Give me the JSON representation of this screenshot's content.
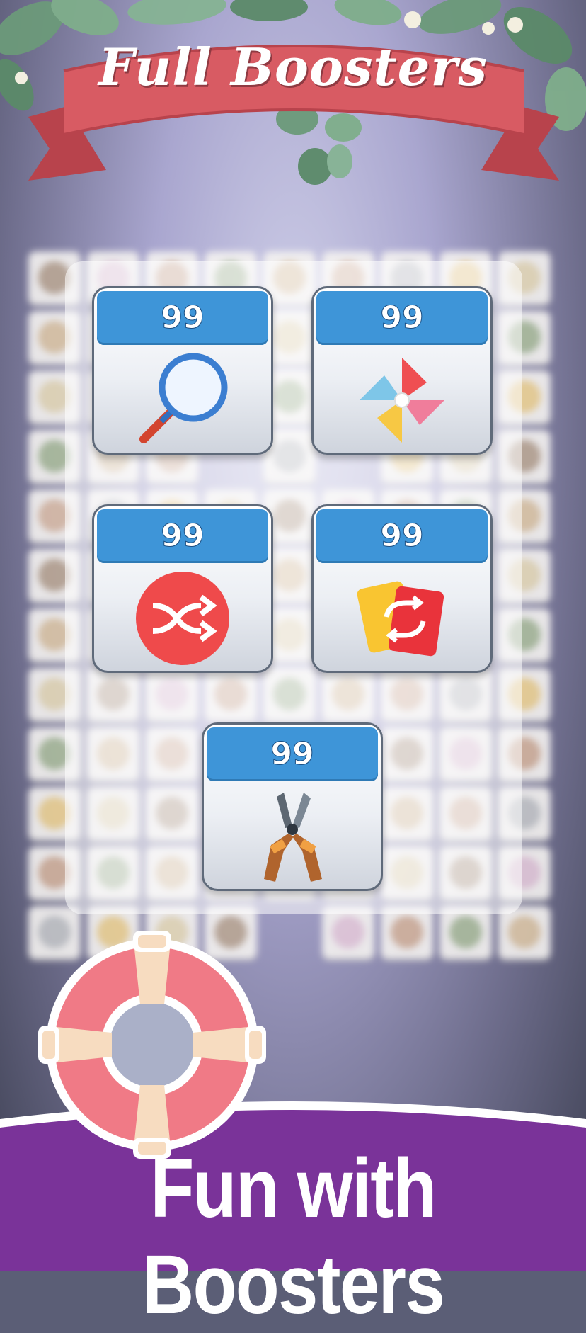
{
  "banner": {
    "title": "Full Boosters"
  },
  "boosters": [
    {
      "name": "search-icon",
      "count": "99"
    },
    {
      "name": "pinwheel-icon",
      "count": "99"
    },
    {
      "name": "shuffle-icon",
      "count": "99"
    },
    {
      "name": "swap-cards-icon",
      "count": "99"
    },
    {
      "name": "pruning-shears-icon",
      "count": "99"
    }
  ],
  "footer": {
    "tagline": "Fun with Boosters"
  },
  "colors": {
    "ribbon": "#d85b63",
    "header_blue": "#3e95d8",
    "footer_purple": "#7a3399",
    "lifebuoy": "#f07a86"
  }
}
